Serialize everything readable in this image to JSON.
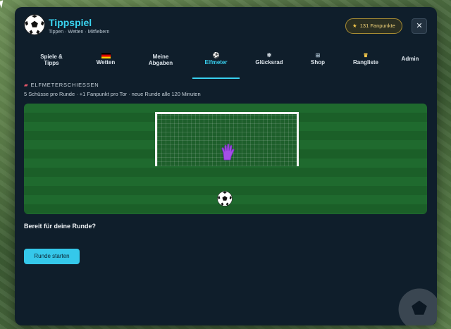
{
  "app": {
    "title": "Tippspiel",
    "subtitle": "Tippen · Wetten · Mitfiebern"
  },
  "header": {
    "fanpoints_label": "131 Fanpunkte",
    "close_symbol": "✕"
  },
  "tabs": [
    {
      "line1": "Spiele &",
      "line2": "Tipps",
      "icon": ""
    },
    {
      "line1": "Wetten",
      "line2": "",
      "icon": "flag-de-icon"
    },
    {
      "line1": "Meine",
      "line2": "Abgaben",
      "icon": ""
    },
    {
      "line1": "Elfmeter",
      "line2": "",
      "icon": "football-icon",
      "active": true
    },
    {
      "line1": "Glücksrad",
      "line2": "",
      "icon": "wheel-icon"
    },
    {
      "line1": "Shop",
      "line2": "",
      "icon": "cart-icon"
    },
    {
      "line1": "Rangliste",
      "line2": "",
      "icon": "trophy-icon"
    },
    {
      "line1": "Admin",
      "line2": "",
      "icon": ""
    }
  ],
  "game": {
    "section_label": "ELFMETERSCHIESSEN",
    "description": "5 Schüsse pro Runde · +1 Fanpunkt pro Tor · neue Runde alle 120 Minuten",
    "ready_text": "Bereit für deine Runde?",
    "start_button": "Runde starten"
  },
  "colors": {
    "accent": "#39d1f0",
    "panel": "#0f1e2b",
    "pitch": "#1f6a2e",
    "badge_gold": "#f1d37a"
  }
}
